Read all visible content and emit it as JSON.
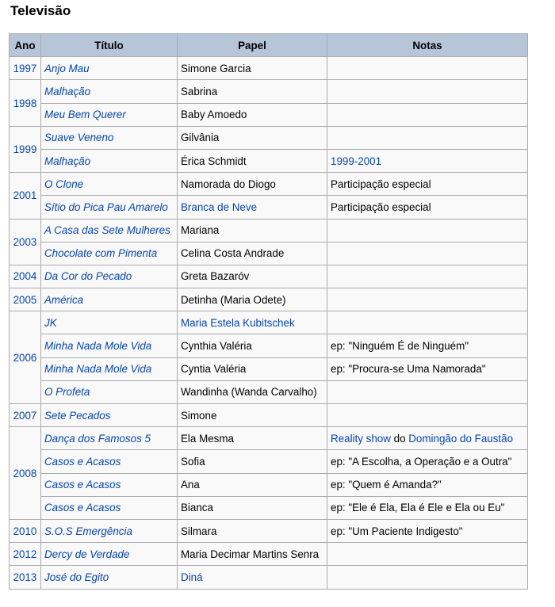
{
  "heading": "Televisão",
  "columns": [
    "Ano",
    "Título",
    "Papel",
    "Notas"
  ],
  "rows": [
    {
      "year": "1997",
      "rowspan": 1,
      "title": "Anjo Mau",
      "role": "Simone Garcia",
      "role_link": false,
      "notes": "",
      "notes_link": false
    },
    {
      "year": "1998",
      "rowspan": 2,
      "title": "Malhação",
      "role": "Sabrina",
      "role_link": false,
      "notes": "",
      "notes_link": false
    },
    {
      "title": "Meu Bem Querer",
      "role": "Baby Amoedo",
      "role_link": false,
      "notes": "",
      "notes_link": false
    },
    {
      "year": "1999",
      "rowspan": 2,
      "title": "Suave Veneno",
      "role": "Gilvânia",
      "role_link": false,
      "notes": "",
      "notes_link": false
    },
    {
      "title": "Malhação",
      "role": "Érica Schmidt",
      "role_link": false,
      "notes": "1999-2001",
      "notes_link": true
    },
    {
      "year": "2001",
      "rowspan": 2,
      "title": "O Clone",
      "role": "Namorada do Diogo",
      "role_link": false,
      "notes": "Participação especial",
      "notes_link": false
    },
    {
      "title": "Sítio do Pica Pau Amarelo",
      "role": "Branca de Neve",
      "role_link": true,
      "notes": "Participação especial",
      "notes_link": false
    },
    {
      "year": "2003",
      "rowspan": 2,
      "title": "A Casa das Sete Mulheres",
      "role": "Mariana",
      "role_link": false,
      "notes": "",
      "notes_link": false
    },
    {
      "title": "Chocolate com Pimenta",
      "role": "Celina Costa Andrade",
      "role_link": false,
      "notes": "",
      "notes_link": false
    },
    {
      "year": "2004",
      "rowspan": 1,
      "title": "Da Cor do Pecado",
      "role": "Greta Bazaróv",
      "role_link": false,
      "notes": "",
      "notes_link": false
    },
    {
      "year": "2005",
      "rowspan": 1,
      "title": "América",
      "role": "Detinha (Maria Odete)",
      "role_link": false,
      "notes": "",
      "notes_link": false
    },
    {
      "year": "2006",
      "rowspan": 4,
      "title": "JK",
      "role": "Maria Estela Kubitschek",
      "role_link": true,
      "notes": "",
      "notes_link": false
    },
    {
      "title": "Minha Nada Mole Vida",
      "role": "Cynthia Valéria",
      "role_link": false,
      "notes": "ep: \"Ninguém É de Ninguém\"",
      "notes_link": false
    },
    {
      "title": "Minha Nada Mole Vida",
      "role": "Cyntia Valéria",
      "role_link": false,
      "notes": "ep: \"Procura-se Uma Namorada\"",
      "notes_link": false
    },
    {
      "title": "O Profeta",
      "role": "Wandinha (Wanda Carvalho)",
      "role_link": false,
      "notes": "",
      "notes_link": false
    },
    {
      "year": "2007",
      "rowspan": 1,
      "title": "Sete Pecados",
      "role": "Simone",
      "role_link": false,
      "notes": "",
      "notes_link": false
    },
    {
      "year": "2008",
      "rowspan": 4,
      "title": "Dança dos Famosos 5",
      "role": "Ela Mesma",
      "role_link": false,
      "notes_parts": [
        {
          "text": "Reality show",
          "link": true
        },
        {
          "text": " do ",
          "link": false
        },
        {
          "text": "Domingão do Faustão",
          "link": true
        }
      ]
    },
    {
      "title": "Casos e Acasos",
      "role": "Sofia",
      "role_link": false,
      "notes": "ep: \"A Escolha, a Operação e a Outra\"",
      "notes_link": false
    },
    {
      "title": "Casos e Acasos",
      "role": "Ana",
      "role_link": false,
      "notes": "ep: \"Quem é Amanda?\"",
      "notes_link": false
    },
    {
      "title": "Casos e Acasos",
      "role": "Bianca",
      "role_link": false,
      "notes": "ep: \"Ele é Ela, Ela é Ele e Ela ou Eu\"",
      "notes_link": false
    },
    {
      "year": "2010",
      "rowspan": 1,
      "title": "S.O.S Emergência",
      "role": "Silmara",
      "role_link": false,
      "notes": "ep: \"Um Paciente Indigesto\"",
      "notes_link": false
    },
    {
      "year": "2012",
      "rowspan": 1,
      "title": "Dercy de Verdade",
      "role": "Maria Decimar Martins Senra",
      "role_link": false,
      "notes": "",
      "notes_link": false
    },
    {
      "year": "2013",
      "rowspan": 1,
      "title": "José do Egito",
      "role": "Diná",
      "role_link": true,
      "notes": "",
      "notes_link": false
    }
  ]
}
